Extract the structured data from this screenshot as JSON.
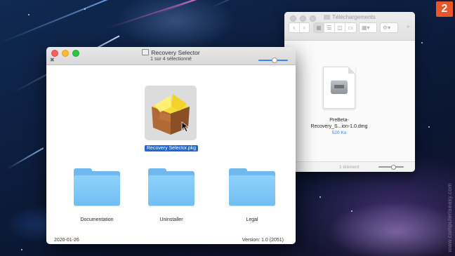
{
  "badge": {
    "number": "2"
  },
  "watermark": {
    "text": "www.computeriseasy.com"
  },
  "finder": {
    "title": "Téléchargements",
    "file": {
      "name_line1": "PreBeta-",
      "name_line2": "Recovery_S...ion-1.0.dmg",
      "size": "520 Ko",
      "icon": "dmg-disk-image-icon"
    },
    "status": "1 élément"
  },
  "window": {
    "title": "Recovery Selector",
    "selection_status": "1 sur 4 sélectionné",
    "package": {
      "label": "Recovery Selector.pkg",
      "icon": "package-box-icon"
    },
    "folders": [
      {
        "label": "Documentation"
      },
      {
        "label": "Uninstaller"
      },
      {
        "label": "Legal"
      }
    ],
    "footer_left": "2020-01-26",
    "footer_right": "Version: 1.0 (2051)",
    "icon_size_slider": 0.5
  },
  "colors": {
    "accent": "#1d65d8",
    "badge": "#e8562a",
    "folder": "#71bdf2"
  }
}
